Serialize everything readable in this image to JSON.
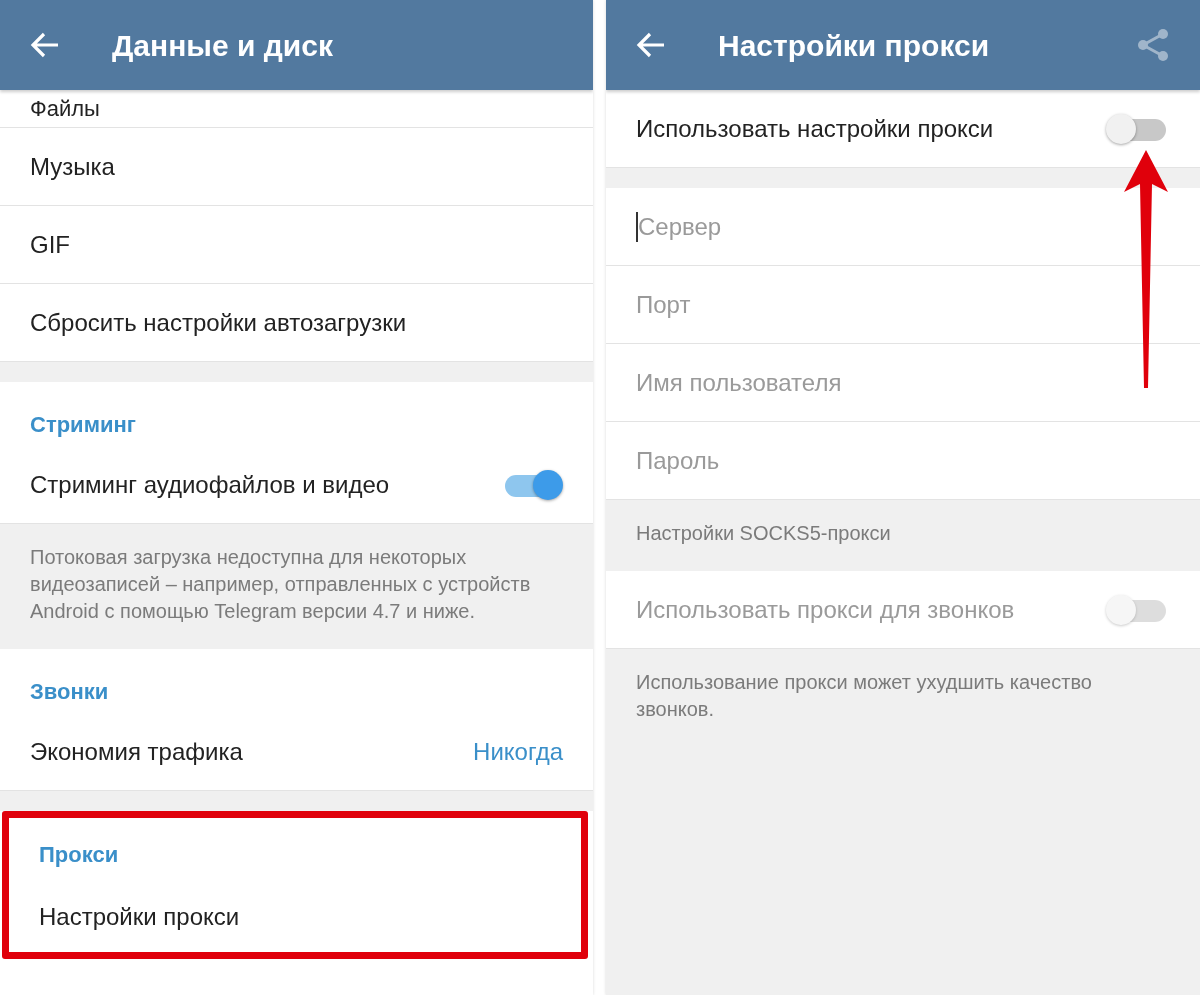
{
  "screens": [
    {
      "title": "Данные и диск",
      "items": [
        {
          "kind": "row",
          "label": "Файлы",
          "partial": true
        },
        {
          "kind": "row",
          "label": "Музыка"
        },
        {
          "kind": "row",
          "label": "GIF"
        },
        {
          "kind": "row",
          "label": "Сбросить настройки автозагрузки"
        },
        {
          "kind": "gap"
        },
        {
          "kind": "section",
          "label": "Стриминг"
        },
        {
          "kind": "toggle",
          "label": "Стриминг аудиофайлов и видео",
          "on": true,
          "disabled": false
        },
        {
          "kind": "info",
          "text": "Потоковая загрузка недоступна для некоторых видеозаписей – например, отправленных с устройств Android с помощью Telegram версии 4.7 и ниже."
        },
        {
          "kind": "section",
          "label": "Звонки"
        },
        {
          "kind": "value",
          "label": "Экономия трафика",
          "value": "Никогда"
        },
        {
          "kind": "gap"
        },
        {
          "kind": "highlight",
          "children": [
            {
              "kind": "section",
              "label": "Прокси"
            },
            {
              "kind": "row",
              "label": "Настройки прокси"
            }
          ]
        }
      ]
    },
    {
      "title": "Настройки прокси",
      "share": {
        "disabled": true
      },
      "items": [
        {
          "kind": "toggle",
          "label": "Использовать настройки прокси",
          "on": false,
          "disabled": false,
          "pointed": true
        },
        {
          "kind": "gap"
        },
        {
          "kind": "field",
          "placeholder": "Сервер",
          "focused": true
        },
        {
          "kind": "field",
          "placeholder": "Порт",
          "focused": false
        },
        {
          "kind": "field",
          "placeholder": "Имя пользователя",
          "focused": false
        },
        {
          "kind": "field",
          "placeholder": "Пароль",
          "focused": false
        },
        {
          "kind": "info",
          "text": "Настройки SOCKS5-прокси"
        },
        {
          "kind": "toggle",
          "label": "Использовать прокси для звонков",
          "on": false,
          "disabled": true
        },
        {
          "kind": "info",
          "text": "Использование прокси может ухудшить качество звонков."
        }
      ]
    }
  ]
}
